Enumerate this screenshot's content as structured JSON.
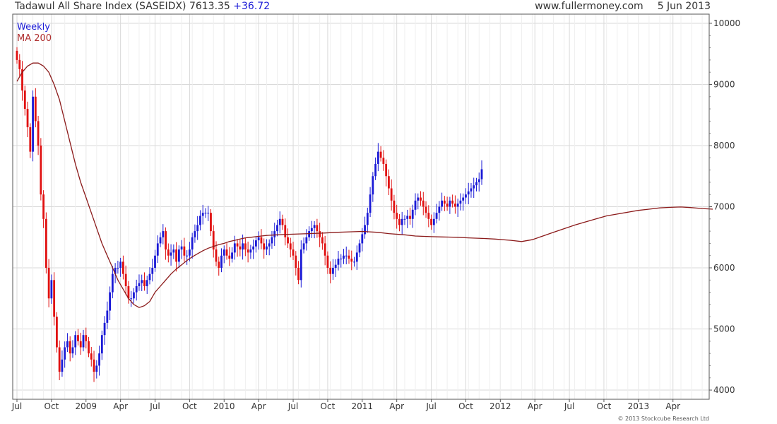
{
  "header": {
    "title": "Tadawul All Share Index (SASEIDX)",
    "last": "7613.35",
    "change": "+36.72",
    "site": "www.fullermoney.com",
    "date": "5 Jun 2013"
  },
  "legend": {
    "weekly": "Weekly",
    "ma": "MA 200"
  },
  "copyright": "© 2013 Stockcube Research Ltd",
  "colors": {
    "up": "#1a1ad6",
    "down": "#e01010",
    "ma": "#8b1a1a",
    "grid": "#d9d9d9",
    "axis": "#333333"
  },
  "chart_data": {
    "type": "line",
    "title": "Tadawul All Share Index (SASEIDX)",
    "ylim": [
      3850,
      10150
    ],
    "yticks": [
      4000,
      5000,
      6000,
      7000,
      8000,
      9000,
      10000
    ],
    "grid": true,
    "legend_position": "top-left",
    "x_ticks": [
      {
        "label": "Jul",
        "t": 0
      },
      {
        "label": "Oct",
        "t": 13
      },
      {
        "label": "2009",
        "t": 26
      },
      {
        "label": "Apr",
        "t": 39
      },
      {
        "label": "Jul",
        "t": 52
      },
      {
        "label": "Oct",
        "t": 65
      },
      {
        "label": "2010",
        "t": 78
      },
      {
        "label": "Apr",
        "t": 91
      },
      {
        "label": "Jul",
        "t": 104
      },
      {
        "label": "Oct",
        "t": 117
      },
      {
        "label": "2011",
        "t": 130
      },
      {
        "label": "Apr",
        "t": 143
      },
      {
        "label": "Jul",
        "t": 156
      },
      {
        "label": "Oct",
        "t": 169
      },
      {
        "label": "2012",
        "t": 182
      },
      {
        "label": "Apr",
        "t": 195
      },
      {
        "label": "Jul",
        "t": 208
      },
      {
        "label": "Oct",
        "t": 221
      },
      {
        "label": "2013",
        "t": 234
      },
      {
        "label": "Apr",
        "t": 247
      }
    ],
    "series": [
      {
        "name": "Weekly",
        "style": "candlestick",
        "t0": 0,
        "close": [
          9400,
          9250,
          8900,
          8600,
          8300,
          7900,
          8800,
          8400,
          8000,
          7200,
          6800,
          6000,
          5500,
          5800,
          5200,
          4700,
          4300,
          4500,
          4700,
          4800,
          4600,
          4700,
          4900,
          4800,
          4700,
          4900,
          4800,
          4600,
          4500,
          4300,
          4400,
          4600,
          4900,
          5100,
          5300,
          5600,
          5900,
          6000,
          6000,
          6100,
          5900,
          5700,
          5500,
          5500,
          5600,
          5700,
          5750,
          5800,
          5700,
          5800,
          5900,
          6000,
          6200,
          6400,
          6500,
          6600,
          6300,
          6200,
          6250,
          6300,
          6100,
          6300,
          6350,
          6200,
          6200,
          6300,
          6500,
          6600,
          6700,
          6850,
          6900,
          6900,
          6900,
          6600,
          6300,
          6100,
          6000,
          6200,
          6300,
          6200,
          6150,
          6250,
          6400,
          6350,
          6300,
          6400,
          6300,
          6250,
          6300,
          6350,
          6450,
          6500,
          6400,
          6300,
          6350,
          6400,
          6500,
          6600,
          6700,
          6800,
          6700,
          6500,
          6400,
          6300,
          6200,
          6000,
          5800,
          6300,
          6400,
          6500,
          6600,
          6650,
          6700,
          6600,
          6500,
          6400,
          6200,
          6000,
          5900,
          6000,
          6050,
          6150,
          6150,
          6200,
          6200,
          6150,
          6100,
          6100,
          6250,
          6400,
          6550,
          6700,
          6900,
          7200,
          7500,
          7700,
          7900,
          7800,
          7700,
          7500,
          7300,
          7100,
          6900,
          6800,
          6700,
          6800,
          6800,
          6850,
          6800,
          6950,
          7100,
          7150,
          7100,
          7000,
          6900,
          6800,
          6700,
          6800,
          6900,
          7000,
          7100,
          7050,
          7000,
          7100,
          7050,
          7000,
          7050,
          7100,
          7150,
          7200,
          7250,
          7300,
          7350,
          7400,
          7450,
          7613
        ]
      },
      {
        "name": "MA 200",
        "style": "line",
        "x": [
          0,
          2,
          4,
          6,
          8,
          10,
          12,
          14,
          16,
          18,
          20,
          22,
          24,
          26,
          28,
          30,
          32,
          34,
          36,
          38,
          40,
          42,
          44,
          46,
          48,
          50,
          52,
          54,
          56,
          58,
          60,
          62,
          64,
          66,
          68,
          70,
          72,
          74,
          76,
          78,
          80,
          82,
          84,
          86,
          88,
          90,
          92,
          94,
          96,
          98,
          100,
          104,
          110,
          116,
          120,
          126,
          130,
          136,
          140,
          146,
          150,
          156,
          160,
          166,
          170,
          176,
          180,
          186,
          190,
          194,
          198,
          202,
          206,
          210,
          214,
          218,
          222,
          226,
          230,
          234,
          238,
          242,
          246,
          250,
          254,
          258,
          262
        ],
        "y": [
          9050,
          9200,
          9300,
          9350,
          9350,
          9300,
          9200,
          9000,
          8750,
          8400,
          8050,
          7700,
          7400,
          7150,
          6900,
          6650,
          6400,
          6200,
          6000,
          5800,
          5650,
          5500,
          5400,
          5350,
          5380,
          5450,
          5600,
          5700,
          5800,
          5900,
          5980,
          6050,
          6120,
          6180,
          6230,
          6280,
          6320,
          6350,
          6380,
          6400,
          6430,
          6450,
          6470,
          6490,
          6500,
          6510,
          6520,
          6530,
          6535,
          6540,
          6545,
          6550,
          6560,
          6570,
          6580,
          6590,
          6595,
          6580,
          6560,
          6540,
          6520,
          6510,
          6505,
          6500,
          6490,
          6480,
          6470,
          6450,
          6430,
          6460,
          6520,
          6580,
          6640,
          6700,
          6750,
          6800,
          6850,
          6880,
          6910,
          6940,
          6960,
          6980,
          6990,
          6995,
          6985,
          6970,
          6960
        ]
      }
    ]
  }
}
